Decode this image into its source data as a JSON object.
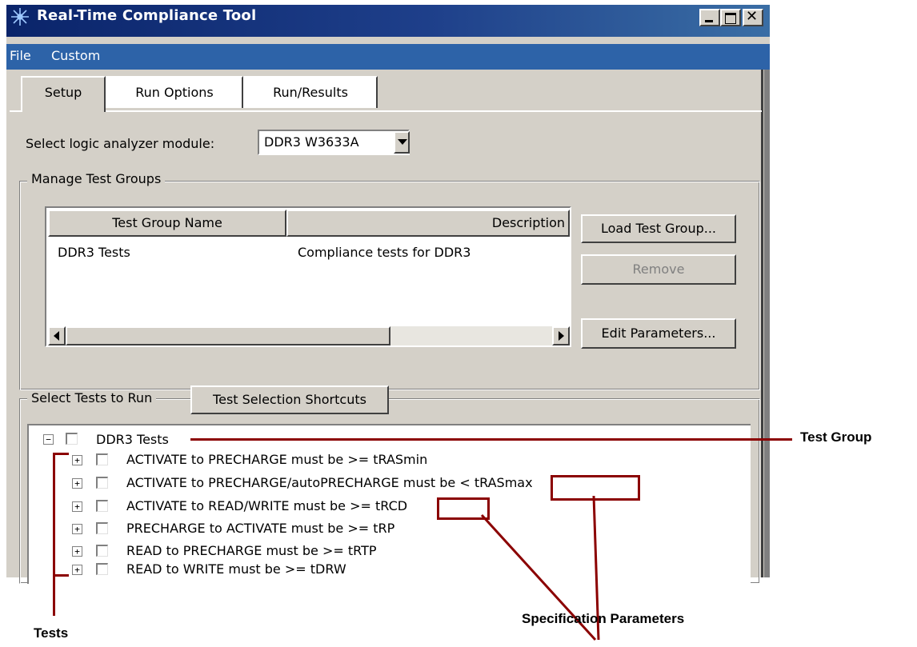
{
  "window": {
    "title": "Real-Time Compliance Tool"
  },
  "menu": {
    "items": [
      "File",
      "Custom"
    ]
  },
  "tabs": [
    {
      "label": "Setup"
    },
    {
      "label": "Run Options"
    },
    {
      "label": "Run/Results"
    }
  ],
  "setup": {
    "module_label": "Select logic analyzer module:",
    "module_value": "DDR3 W3633A",
    "manage_groups_title": "Manage Test Groups",
    "table": {
      "columns": [
        "Test Group Name",
        "Description"
      ],
      "rows": [
        {
          "name": "DDR3 Tests",
          "description": "Compliance tests for DDR3"
        }
      ]
    },
    "buttons": {
      "load": "Load Test Group...",
      "remove": "Remove",
      "edit": "Edit Parameters..."
    },
    "select_tests_title": "Select Tests to Run",
    "shortcuts_label": "Test Selection Shortcuts",
    "tree": {
      "group": "DDR3 Tests",
      "tests": [
        "ACTIVATE to PRECHARGE must be >= tRASmin",
        "ACTIVATE to PRECHARGE/autoPRECHARGE must be < tRASmax",
        "ACTIVATE to READ/WRITE must be >= tRCD",
        "PRECHARGE to ACTIVATE must be >= tRP",
        "READ to PRECHARGE must be >= tRTP",
        "READ to WRITE must be >= tDRW"
      ]
    }
  },
  "annotations": {
    "test_group": "Test Group",
    "tests": "Tests",
    "spec_params": "Specification Parameters",
    "color": "#8b0000"
  }
}
